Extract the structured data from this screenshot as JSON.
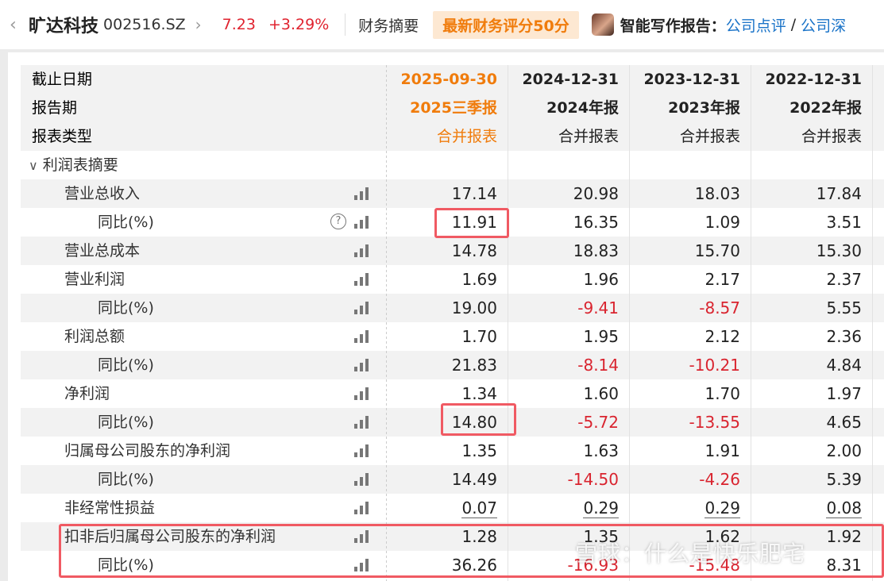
{
  "header": {
    "back_icon": "chevron-left-icon",
    "stock_name": "旷达科技",
    "stock_code": "002516.SZ",
    "next_icon": "chevron-right-icon",
    "price": "7.23",
    "change": "+3.29%",
    "summary_label": "财务摘要",
    "score_badge": "最新财务评分50分",
    "writer_label": "智能写作报告：",
    "link1": "公司点评",
    "slash": "/",
    "link2": "公司深",
    "colors": {
      "up": "#e0232f",
      "accent": "#f07c0c",
      "link": "#1a73c8"
    }
  },
  "table": {
    "head_labels": [
      "截止日期",
      "报告期",
      "报表类型"
    ],
    "columns": [
      {
        "date": "2025-09-30",
        "period": "2025三季报",
        "type": "合并报表"
      },
      {
        "date": "2024-12-31",
        "period": "2024年报",
        "type": "合并报表"
      },
      {
        "date": "2023-12-31",
        "period": "2023年报",
        "type": "合并报表"
      },
      {
        "date": "2022-12-31",
        "period": "2022年报",
        "type": "合并报表"
      }
    ],
    "section": {
      "label": "利润表摘要",
      "icon": "chevron-down-icon"
    },
    "rows": [
      {
        "label": "营业总收入",
        "values": [
          "17.14",
          "20.98",
          "18.03",
          "17.84"
        ]
      },
      {
        "label": "同比(%)",
        "values": [
          "11.91",
          "16.35",
          "1.09",
          "3.51"
        ]
      },
      {
        "label": "营业总成本",
        "values": [
          "14.78",
          "18.83",
          "15.70",
          "15.30"
        ]
      },
      {
        "label": "营业利润",
        "values": [
          "1.69",
          "1.96",
          "2.17",
          "2.37"
        ]
      },
      {
        "label": "同比(%)",
        "values": [
          "19.00",
          "-9.41",
          "-8.57",
          "5.55"
        ]
      },
      {
        "label": "利润总额",
        "values": [
          "1.70",
          "1.95",
          "2.12",
          "2.36"
        ]
      },
      {
        "label": "同比(%)",
        "values": [
          "21.83",
          "-8.14",
          "-10.21",
          "4.84"
        ]
      },
      {
        "label": "净利润",
        "values": [
          "1.34",
          "1.60",
          "1.70",
          "1.97"
        ]
      },
      {
        "label": "同比(%)",
        "values": [
          "14.80",
          "-5.72",
          "-13.55",
          "4.65"
        ]
      },
      {
        "label": "归属母公司股东的净利润",
        "values": [
          "1.35",
          "1.63",
          "1.91",
          "2.00"
        ]
      },
      {
        "label": "同比(%)",
        "values": [
          "14.49",
          "-14.50",
          "-4.26",
          "5.39"
        ]
      },
      {
        "label": "非经常性损益",
        "values": [
          "0.07",
          "0.29",
          "0.29",
          "0.08"
        ]
      },
      {
        "label": "扣非后归属母公司股东的净利润",
        "values": [
          "1.28",
          "1.35",
          "1.62",
          "1.92"
        ]
      },
      {
        "label": "同比(%)",
        "values": [
          "36.26",
          "-16.93",
          "-15.48",
          "8.31"
        ]
      }
    ],
    "help_icon": "question-circle-icon",
    "chart_icon": "bar-chart-icon",
    "negative_color": "#d9242f"
  },
  "watermark": "雪球：什么是快乐肥宅"
}
